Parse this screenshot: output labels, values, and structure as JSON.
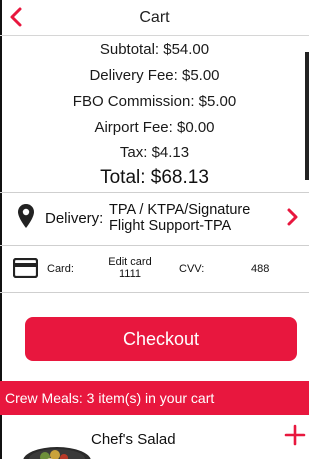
{
  "header": {
    "title": "Cart"
  },
  "summary": {
    "subtotal": "Subtotal: $54.00",
    "delivery_fee": "Delivery Fee: $5.00",
    "fbo_commission": "FBO Commission: $5.00",
    "airport_fee": "Airport Fee: $0.00",
    "tax": "Tax: $4.13",
    "total": "Total: $68.13"
  },
  "delivery": {
    "label": "Delivery:",
    "value_line1": "TPA / KTPA/Signature",
    "value_line2": "Flight Support-TPA"
  },
  "payment": {
    "card_label": "Card:",
    "edit_label": "Edit card",
    "card_number": "1111",
    "cvv_label": "CVV:",
    "cvv_value": "488"
  },
  "checkout": {
    "label": "Checkout"
  },
  "banner": {
    "text": "Crew Meals: 3 item(s) in your cart"
  },
  "items": [
    {
      "name": "Chef's Salad"
    }
  ],
  "icons": {
    "back": "chevron-left-icon",
    "location": "map-pin-icon",
    "delivery_nav": "chevron-right-icon",
    "card": "credit-card-icon",
    "add": "plus-icon"
  },
  "colors": {
    "accent": "#e8173e",
    "text": "#111111",
    "divider": "#cfcfcf"
  }
}
